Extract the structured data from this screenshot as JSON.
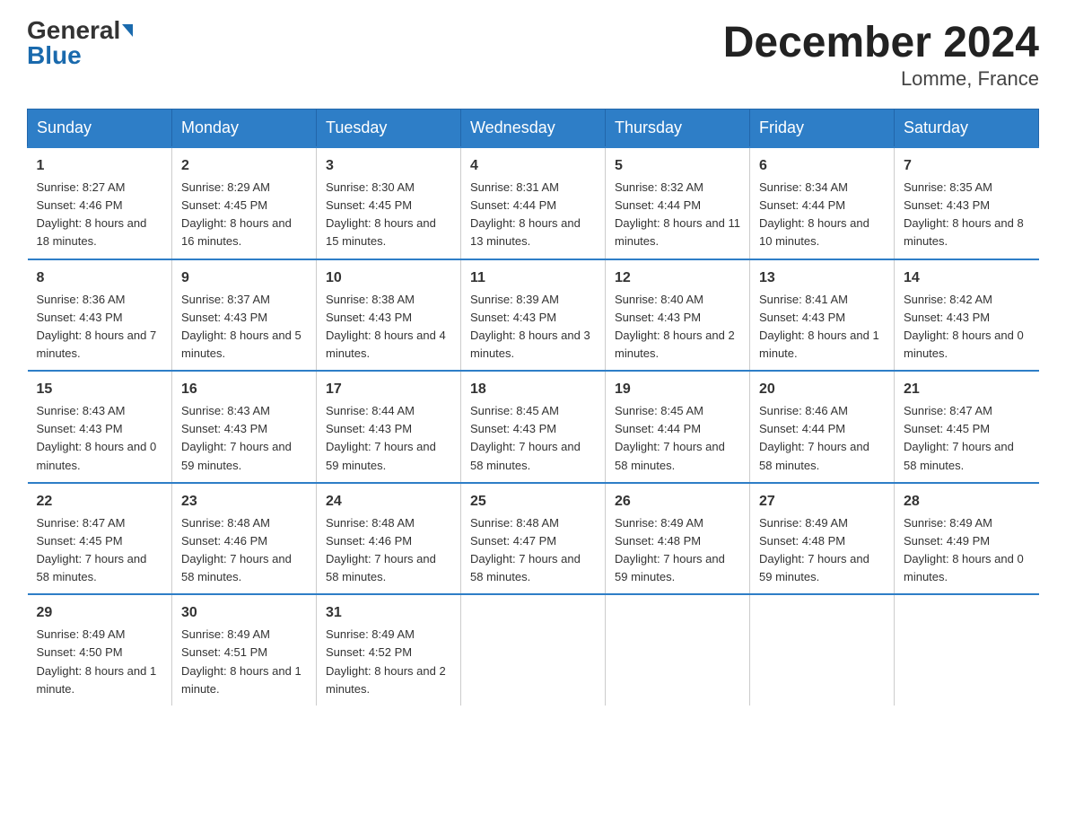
{
  "header": {
    "logo_general": "General",
    "logo_blue": "Blue",
    "title": "December 2024",
    "subtitle": "Lomme, France"
  },
  "days_of_week": [
    "Sunday",
    "Monday",
    "Tuesday",
    "Wednesday",
    "Thursday",
    "Friday",
    "Saturday"
  ],
  "weeks": [
    [
      {
        "day": "1",
        "sunrise": "Sunrise: 8:27 AM",
        "sunset": "Sunset: 4:46 PM",
        "daylight": "Daylight: 8 hours and 18 minutes."
      },
      {
        "day": "2",
        "sunrise": "Sunrise: 8:29 AM",
        "sunset": "Sunset: 4:45 PM",
        "daylight": "Daylight: 8 hours and 16 minutes."
      },
      {
        "day": "3",
        "sunrise": "Sunrise: 8:30 AM",
        "sunset": "Sunset: 4:45 PM",
        "daylight": "Daylight: 8 hours and 15 minutes."
      },
      {
        "day": "4",
        "sunrise": "Sunrise: 8:31 AM",
        "sunset": "Sunset: 4:44 PM",
        "daylight": "Daylight: 8 hours and 13 minutes."
      },
      {
        "day": "5",
        "sunrise": "Sunrise: 8:32 AM",
        "sunset": "Sunset: 4:44 PM",
        "daylight": "Daylight: 8 hours and 11 minutes."
      },
      {
        "day": "6",
        "sunrise": "Sunrise: 8:34 AM",
        "sunset": "Sunset: 4:44 PM",
        "daylight": "Daylight: 8 hours and 10 minutes."
      },
      {
        "day": "7",
        "sunrise": "Sunrise: 8:35 AM",
        "sunset": "Sunset: 4:43 PM",
        "daylight": "Daylight: 8 hours and 8 minutes."
      }
    ],
    [
      {
        "day": "8",
        "sunrise": "Sunrise: 8:36 AM",
        "sunset": "Sunset: 4:43 PM",
        "daylight": "Daylight: 8 hours and 7 minutes."
      },
      {
        "day": "9",
        "sunrise": "Sunrise: 8:37 AM",
        "sunset": "Sunset: 4:43 PM",
        "daylight": "Daylight: 8 hours and 5 minutes."
      },
      {
        "day": "10",
        "sunrise": "Sunrise: 8:38 AM",
        "sunset": "Sunset: 4:43 PM",
        "daylight": "Daylight: 8 hours and 4 minutes."
      },
      {
        "day": "11",
        "sunrise": "Sunrise: 8:39 AM",
        "sunset": "Sunset: 4:43 PM",
        "daylight": "Daylight: 8 hours and 3 minutes."
      },
      {
        "day": "12",
        "sunrise": "Sunrise: 8:40 AM",
        "sunset": "Sunset: 4:43 PM",
        "daylight": "Daylight: 8 hours and 2 minutes."
      },
      {
        "day": "13",
        "sunrise": "Sunrise: 8:41 AM",
        "sunset": "Sunset: 4:43 PM",
        "daylight": "Daylight: 8 hours and 1 minute."
      },
      {
        "day": "14",
        "sunrise": "Sunrise: 8:42 AM",
        "sunset": "Sunset: 4:43 PM",
        "daylight": "Daylight: 8 hours and 0 minutes."
      }
    ],
    [
      {
        "day": "15",
        "sunrise": "Sunrise: 8:43 AM",
        "sunset": "Sunset: 4:43 PM",
        "daylight": "Daylight: 8 hours and 0 minutes."
      },
      {
        "day": "16",
        "sunrise": "Sunrise: 8:43 AM",
        "sunset": "Sunset: 4:43 PM",
        "daylight": "Daylight: 7 hours and 59 minutes."
      },
      {
        "day": "17",
        "sunrise": "Sunrise: 8:44 AM",
        "sunset": "Sunset: 4:43 PM",
        "daylight": "Daylight: 7 hours and 59 minutes."
      },
      {
        "day": "18",
        "sunrise": "Sunrise: 8:45 AM",
        "sunset": "Sunset: 4:43 PM",
        "daylight": "Daylight: 7 hours and 58 minutes."
      },
      {
        "day": "19",
        "sunrise": "Sunrise: 8:45 AM",
        "sunset": "Sunset: 4:44 PM",
        "daylight": "Daylight: 7 hours and 58 minutes."
      },
      {
        "day": "20",
        "sunrise": "Sunrise: 8:46 AM",
        "sunset": "Sunset: 4:44 PM",
        "daylight": "Daylight: 7 hours and 58 minutes."
      },
      {
        "day": "21",
        "sunrise": "Sunrise: 8:47 AM",
        "sunset": "Sunset: 4:45 PM",
        "daylight": "Daylight: 7 hours and 58 minutes."
      }
    ],
    [
      {
        "day": "22",
        "sunrise": "Sunrise: 8:47 AM",
        "sunset": "Sunset: 4:45 PM",
        "daylight": "Daylight: 7 hours and 58 minutes."
      },
      {
        "day": "23",
        "sunrise": "Sunrise: 8:48 AM",
        "sunset": "Sunset: 4:46 PM",
        "daylight": "Daylight: 7 hours and 58 minutes."
      },
      {
        "day": "24",
        "sunrise": "Sunrise: 8:48 AM",
        "sunset": "Sunset: 4:46 PM",
        "daylight": "Daylight: 7 hours and 58 minutes."
      },
      {
        "day": "25",
        "sunrise": "Sunrise: 8:48 AM",
        "sunset": "Sunset: 4:47 PM",
        "daylight": "Daylight: 7 hours and 58 minutes."
      },
      {
        "day": "26",
        "sunrise": "Sunrise: 8:49 AM",
        "sunset": "Sunset: 4:48 PM",
        "daylight": "Daylight: 7 hours and 59 minutes."
      },
      {
        "day": "27",
        "sunrise": "Sunrise: 8:49 AM",
        "sunset": "Sunset: 4:48 PM",
        "daylight": "Daylight: 7 hours and 59 minutes."
      },
      {
        "day": "28",
        "sunrise": "Sunrise: 8:49 AM",
        "sunset": "Sunset: 4:49 PM",
        "daylight": "Daylight: 8 hours and 0 minutes."
      }
    ],
    [
      {
        "day": "29",
        "sunrise": "Sunrise: 8:49 AM",
        "sunset": "Sunset: 4:50 PM",
        "daylight": "Daylight: 8 hours and 1 minute."
      },
      {
        "day": "30",
        "sunrise": "Sunrise: 8:49 AM",
        "sunset": "Sunset: 4:51 PM",
        "daylight": "Daylight: 8 hours and 1 minute."
      },
      {
        "day": "31",
        "sunrise": "Sunrise: 8:49 AM",
        "sunset": "Sunset: 4:52 PM",
        "daylight": "Daylight: 8 hours and 2 minutes."
      },
      {
        "day": "",
        "sunrise": "",
        "sunset": "",
        "daylight": ""
      },
      {
        "day": "",
        "sunrise": "",
        "sunset": "",
        "daylight": ""
      },
      {
        "day": "",
        "sunrise": "",
        "sunset": "",
        "daylight": ""
      },
      {
        "day": "",
        "sunrise": "",
        "sunset": "",
        "daylight": ""
      }
    ]
  ]
}
